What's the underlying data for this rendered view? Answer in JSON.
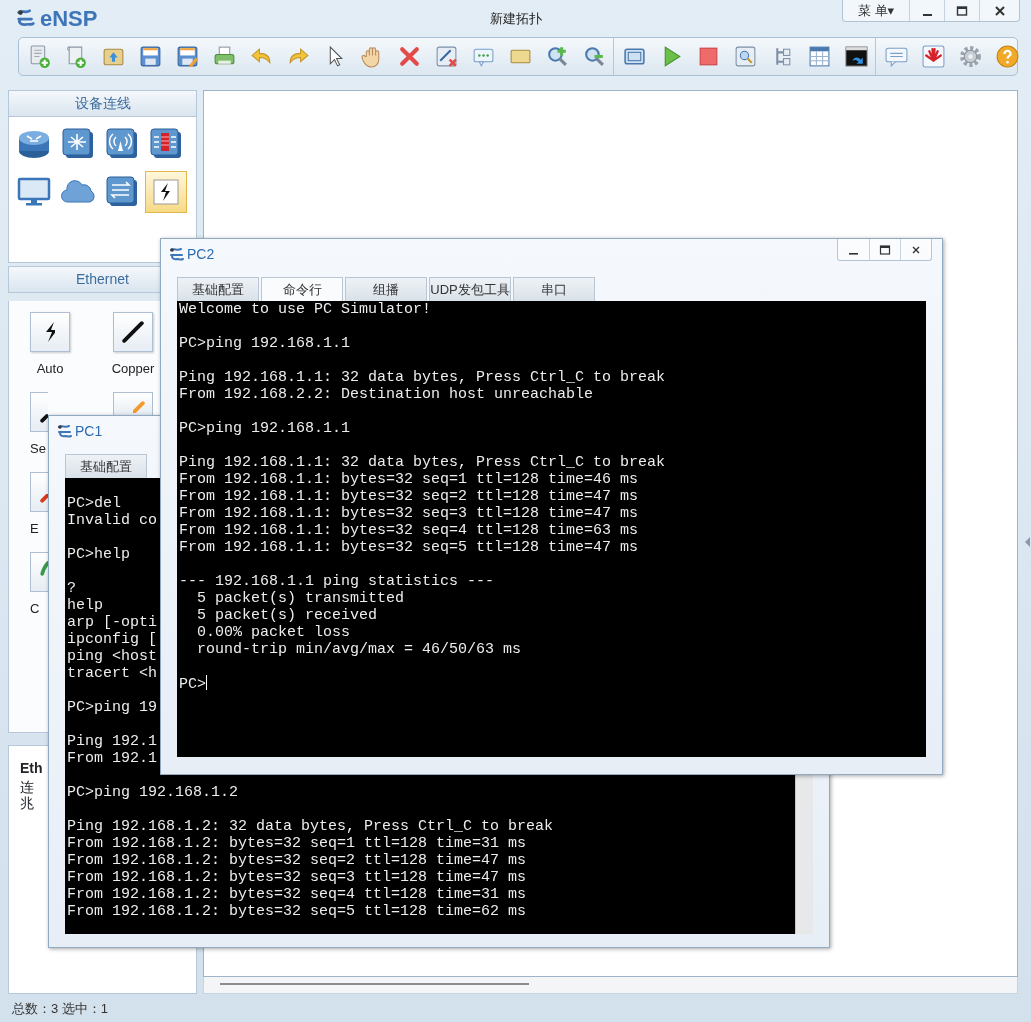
{
  "app": {
    "name": "eNSP",
    "title": "新建拓扑",
    "menu": "菜 单▾"
  },
  "device_panel": {
    "title": "设备连线",
    "devices": [
      {
        "kind": "router",
        "selected": false
      },
      {
        "kind": "switch",
        "selected": false
      },
      {
        "kind": "wireless",
        "selected": false
      },
      {
        "kind": "firewall",
        "selected": false
      },
      {
        "kind": "pc",
        "selected": false
      },
      {
        "kind": "cloud",
        "selected": false
      },
      {
        "kind": "hub",
        "selected": false
      },
      {
        "kind": "cable",
        "selected": true
      }
    ]
  },
  "cable_panel": {
    "title": "Ethernet",
    "rows": [
      [
        {
          "kind": "auto",
          "label": "Auto"
        },
        {
          "kind": "copper",
          "label": "Copper"
        }
      ],
      [
        {
          "kind": "serial",
          "label": "Se"
        },
        {
          "kind": "pos"
        }
      ],
      [
        {
          "kind": "e1",
          "label": "E"
        }
      ],
      [
        {
          "kind": "ce1",
          "label": "C"
        }
      ]
    ]
  },
  "info_panel": {
    "title": "Eth",
    "lines": [
      "连",
      "兆"
    ]
  },
  "windows": [
    {
      "title": "PC1",
      "tabs": [
        {
          "label": "基础配置",
          "selected": false
        }
      ],
      "blocks": [
        [
          "PC>del",
          "Invalid co"
        ],
        [
          "PC>help"
        ],
        [
          "?",
          "help",
          "arp [-opti",
          "ipconfig [",
          "ping <host",
          "tracert <h"
        ],
        [
          "PC>ping 19"
        ],
        [
          "Ping 192.1",
          "From 192.1"
        ],
        [
          "PC>ping 192.168.1.2"
        ],
        [
          "Ping 192.168.1.2: 32 data bytes, Press Ctrl_C to break",
          "From 192.168.1.2: bytes=32 seq=1 ttl=128 time=31 ms",
          "From 192.168.1.2: bytes=32 seq=2 ttl=128 time=47 ms",
          "From 192.168.1.2: bytes=32 seq=3 ttl=128 time=47 ms",
          "From 192.168.1.2: bytes=32 seq=4 ttl=128 time=31 ms",
          "From 192.168.1.2: bytes=32 seq=5 ttl=128 time=62 ms"
        ]
      ]
    },
    {
      "title": "PC2",
      "tabs": [
        {
          "label": "基础配置",
          "selected": false
        },
        {
          "label": "命令行",
          "selected": true
        },
        {
          "label": "组播",
          "selected": false
        },
        {
          "label": "UDP发包工具",
          "selected": false
        },
        {
          "label": "串口",
          "selected": false
        }
      ],
      "cursor": true,
      "blocks": [
        [
          "Welcome to use PC Simulator!"
        ],
        [
          "PC>ping 192.168.1.1"
        ],
        [
          "Ping 192.168.1.1: 32 data bytes, Press Ctrl_C to break",
          "From 192.168.2.2: Destination host unreachable"
        ],
        [
          "PC>ping 192.168.1.1"
        ],
        [
          "Ping 192.168.1.1: 32 data bytes, Press Ctrl_C to break",
          "From 192.168.1.1: bytes=32 seq=1 ttl=128 time=46 ms",
          "From 192.168.1.1: bytes=32 seq=2 ttl=128 time=47 ms",
          "From 192.168.1.1: bytes=32 seq=3 ttl=128 time=47 ms",
          "From 192.168.1.1: bytes=32 seq=4 ttl=128 time=63 ms",
          "From 192.168.1.1: bytes=32 seq=5 ttl=128 time=47 ms"
        ],
        [
          "--- 192.168.1.1 ping statistics ---",
          "  5 packet(s) transmitted",
          "  5 packet(s) received",
          "  0.00% packet loss",
          "  round-trip min/avg/max = 46/50/63 ms"
        ],
        [
          "PC>"
        ]
      ]
    }
  ],
  "status_bar": "总数：3 选中：1"
}
